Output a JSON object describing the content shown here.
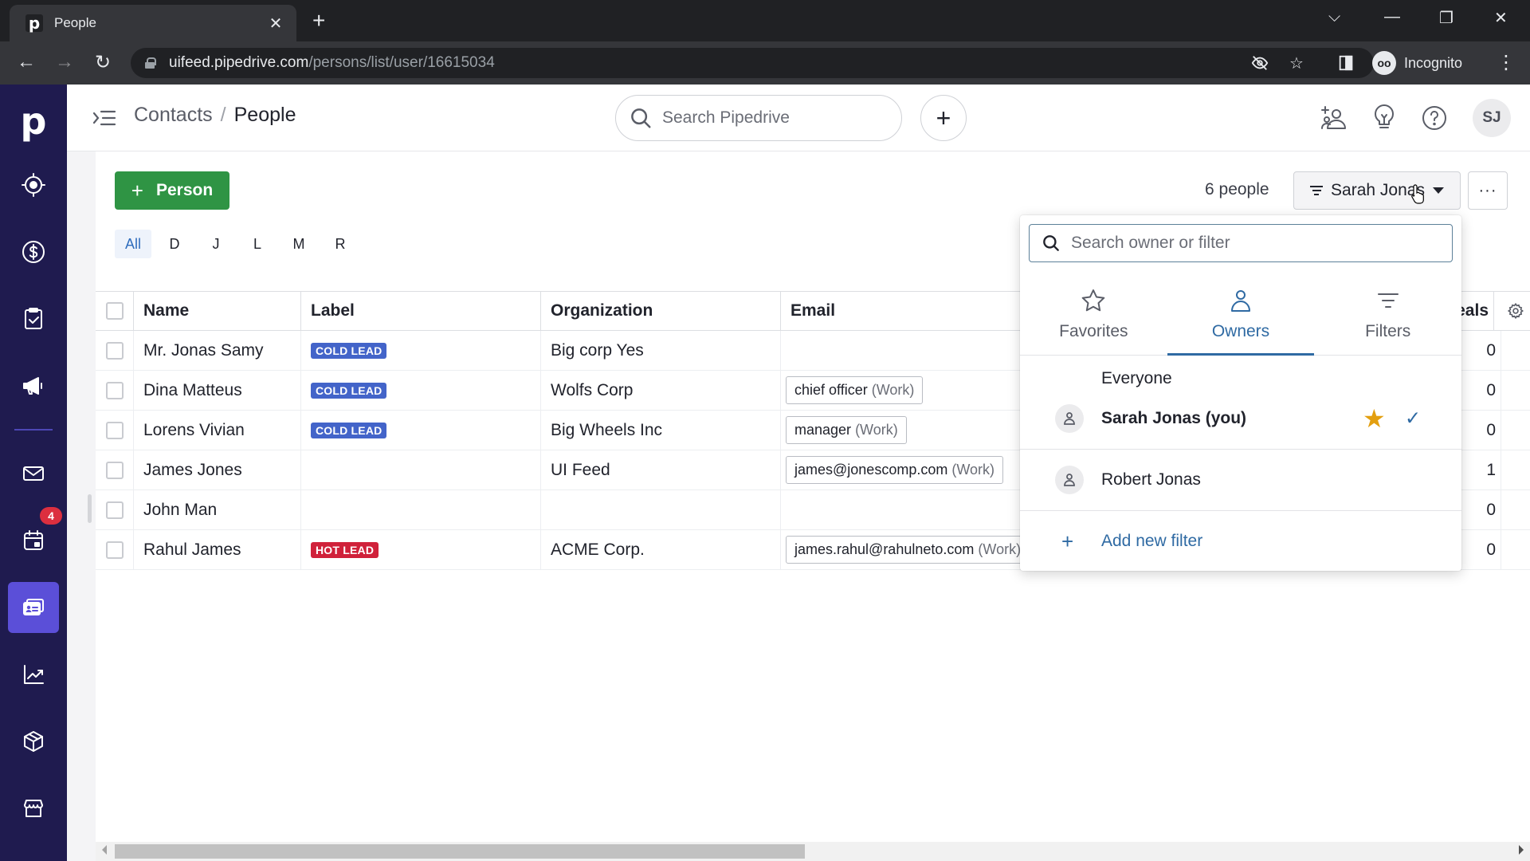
{
  "browser": {
    "tab_title": "People",
    "tab_favicon": "p",
    "url_host": "uifeed.pipedrive.com",
    "url_path": "/persons/list/user/16615034",
    "profile_label": "Incognito"
  },
  "sidebar": {
    "logo": "p",
    "items": [
      {
        "name": "leads",
        "icon": "target-icon"
      },
      {
        "name": "deals",
        "icon": "dollar-icon"
      },
      {
        "name": "activities-tasks",
        "icon": "clipboard-check-icon"
      },
      {
        "name": "campaigns",
        "icon": "megaphone-icon"
      },
      {
        "name": "mail",
        "icon": "envelope-icon"
      },
      {
        "name": "activities",
        "icon": "calendar-icon",
        "badge": "4"
      },
      {
        "name": "contacts",
        "icon": "contact-card-icon",
        "active": true
      },
      {
        "name": "insights",
        "icon": "trend-chart-icon"
      },
      {
        "name": "products",
        "icon": "box-icon"
      },
      {
        "name": "marketplace",
        "icon": "store-icon"
      }
    ]
  },
  "header": {
    "breadcrumb_parent": "Contacts",
    "breadcrumb_separator": "/",
    "breadcrumb_current": "People",
    "search_placeholder": "Search Pipedrive",
    "quick_add": "+",
    "avatar_initials": "SJ"
  },
  "toolbar": {
    "add_person_label": "Person",
    "people_count": "6 people",
    "owner_filter_label": "Sarah Jonas",
    "more_label": "···",
    "alpha_filters": [
      "All",
      "D",
      "J",
      "L",
      "M",
      "R"
    ],
    "alpha_active": "All"
  },
  "table": {
    "columns": [
      "Name",
      "Label",
      "Organization",
      "Email",
      "Deals"
    ],
    "deals_header_visible": "eals",
    "rows": [
      {
        "name": "Mr. Jonas Samy",
        "label": "COLD LEAD",
        "label_color": "#4364c9",
        "organization": "Big corp Yes",
        "email": "",
        "email_type": "",
        "deals": "0"
      },
      {
        "name": "Dina Matteus",
        "label": "COLD LEAD",
        "label_color": "#4364c9",
        "organization": "Wolfs Corp",
        "email": "chief officer",
        "email_type": "(Work)",
        "deals": "0"
      },
      {
        "name": "Lorens Vivian",
        "label": "COLD LEAD",
        "label_color": "#4364c9",
        "organization": "Big Wheels Inc",
        "email": "manager",
        "email_type": "(Work)",
        "deals": "0"
      },
      {
        "name": "James Jones",
        "label": "",
        "label_color": "",
        "organization": "UI Feed",
        "email": "james@jonescomp.com",
        "email_type": "(Work)",
        "deals": "1"
      },
      {
        "name": "John Man",
        "label": "",
        "label_color": "",
        "organization": "",
        "email": "",
        "email_type": "",
        "deals": "0"
      },
      {
        "name": "Rahul James",
        "label": "HOT LEAD",
        "label_color": "#d0213a",
        "organization": "ACME Corp.",
        "email": "james.rahul@rahulneto.com",
        "email_type": "(Work)",
        "deals": "0"
      }
    ]
  },
  "dropdown": {
    "search_placeholder": "Search owner or filter",
    "tabs": [
      {
        "label": "Favorites",
        "icon": "star-outline-icon",
        "active": false
      },
      {
        "label": "Owners",
        "icon": "person-icon",
        "active": true
      },
      {
        "label": "Filters",
        "icon": "filter-icon",
        "active": false
      }
    ],
    "items": [
      {
        "label": "Everyone"
      },
      {
        "label": "Sarah Jonas (you)",
        "favorite": true,
        "selected": true
      },
      {
        "label": "Robert Jonas"
      }
    ],
    "add_filter_label": "Add new filter"
  },
  "colors": {
    "sidebar_bg": "#1f1b4f",
    "sidebar_active": "#5b4fd8",
    "primary_green": "#2f9444",
    "link_blue": "#2f6aa3",
    "favorite_star": "#e39f0f",
    "badge_red": "#dc2f3f"
  }
}
